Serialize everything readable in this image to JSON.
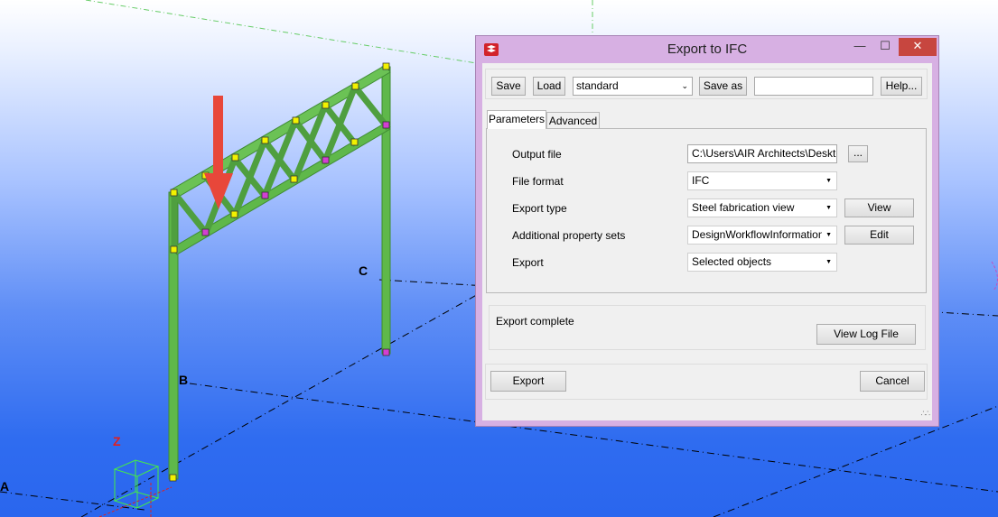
{
  "viewport": {
    "axis_labels": {
      "a": "A",
      "b": "B",
      "c": "C",
      "z": "Z"
    },
    "colors": {
      "beam": "#5fb84a",
      "beam_dark": "#3f8b33",
      "arrow": "#e8473a",
      "node_yellow": "#f2f200",
      "node_magenta": "#d23fd2"
    }
  },
  "dialog": {
    "title": "Export to IFC",
    "window_buttons": {
      "minimize": "—",
      "maximize": "☐",
      "close": "✕"
    },
    "toolbar": {
      "save": "Save",
      "load": "Load",
      "preset_value": "standard",
      "save_as": "Save as",
      "save_as_value": "",
      "help": "Help..."
    },
    "tabs": [
      "Parameters",
      "Advanced"
    ],
    "parameters": {
      "output_file": {
        "label": "Output file",
        "value": "C:\\Users\\AIR Architects\\Desktop",
        "browse": "..."
      },
      "file_format": {
        "label": "File format",
        "value": "IFC"
      },
      "export_type": {
        "label": "Export type",
        "value": "Steel fabrication view",
        "button": "View"
      },
      "property_sets": {
        "label": "Additional property sets",
        "value": "DesignWorkflowInformationTS",
        "button": "Edit"
      },
      "export": {
        "label": "Export",
        "value": "Selected objects"
      }
    },
    "status": {
      "text": "Export complete",
      "view_log": "View Log File"
    },
    "actions": {
      "export": "Export",
      "cancel": "Cancel"
    }
  }
}
